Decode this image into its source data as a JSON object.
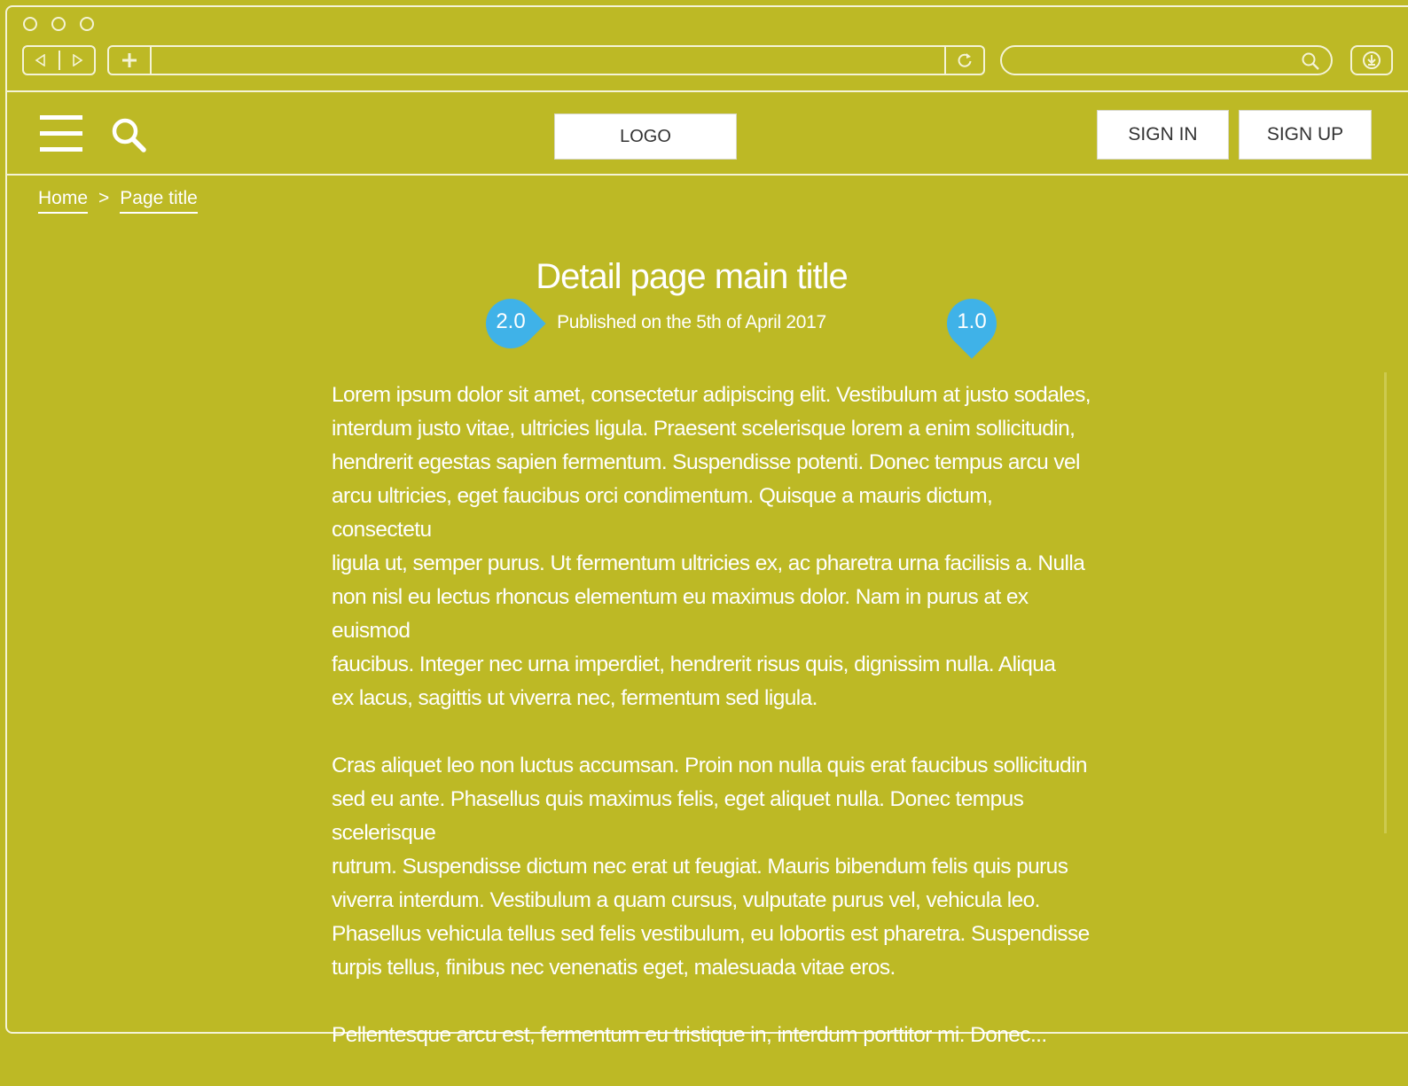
{
  "header": {
    "logo_label": "LOGO",
    "signin_label": "SIGN IN",
    "signup_label": "SIGN UP"
  },
  "breadcrumb": {
    "home": "Home",
    "separator": ">",
    "current": "Page title"
  },
  "article": {
    "title": "Detail page main title",
    "published": "Published on the 5th of April 2017",
    "paragraphs": [
      "Lorem ipsum dolor sit amet, consectetur adipiscing elit. Vestibulum at justo sodales,\ninterdum justo vitae, ultricies ligula. Praesent scelerisque lorem a enim sollicitudin,\nhendrerit egestas sapien fermentum. Suspendisse potenti. Donec tempus arcu vel\narcu ultricies, eget faucibus orci condimentum. Quisque a mauris dictum, consectetu\n ligula ut, semper purus. Ut fermentum ultricies ex, ac pharetra urna facilisis a. Nulla\nnon nisl eu lectus rhoncus elementum eu maximus dolor. Nam in purus at ex euismod\nfaucibus. Integer nec urna imperdiet, hendrerit risus quis, dignissim nulla. Aliqua\nex lacus, sagittis ut viverra nec, fermentum sed ligula.",
      "Cras aliquet leo non luctus accumsan. Proin non nulla quis erat faucibus sollicitudin\nsed eu ante. Phasellus quis maximus felis, eget aliquet nulla. Donec tempus scelerisque\nrutrum. Suspendisse dictum nec erat ut feugiat. Mauris bibendum felis quis purus\nviverra interdum. Vestibulum a quam cursus, vulputate purus vel, vehicula leo.\nPhasellus vehicula tellus sed felis vestibulum, eu lobortis est pharetra. Suspendisse\nturpis tellus, finibus nec venenatis eget, malesuada vitae eros.",
      "Pellentesque arcu est, fermentum eu tristique in, interdum porttitor mi. Donec..."
    ]
  },
  "annotations": {
    "left_pin": "2.0",
    "right_pin": "1.0"
  },
  "colors": {
    "background": "#bdb925",
    "pin": "#3fb2e8"
  },
  "icons": {
    "window_dots": "circle-icon",
    "back": "back-arrow-icon",
    "forward": "forward-arrow-icon",
    "new_tab": "plus-icon",
    "reload": "reload-icon",
    "browser_search": "search-icon",
    "download": "download-icon",
    "menu": "hamburger-menu-icon",
    "site_search": "search-icon"
  }
}
